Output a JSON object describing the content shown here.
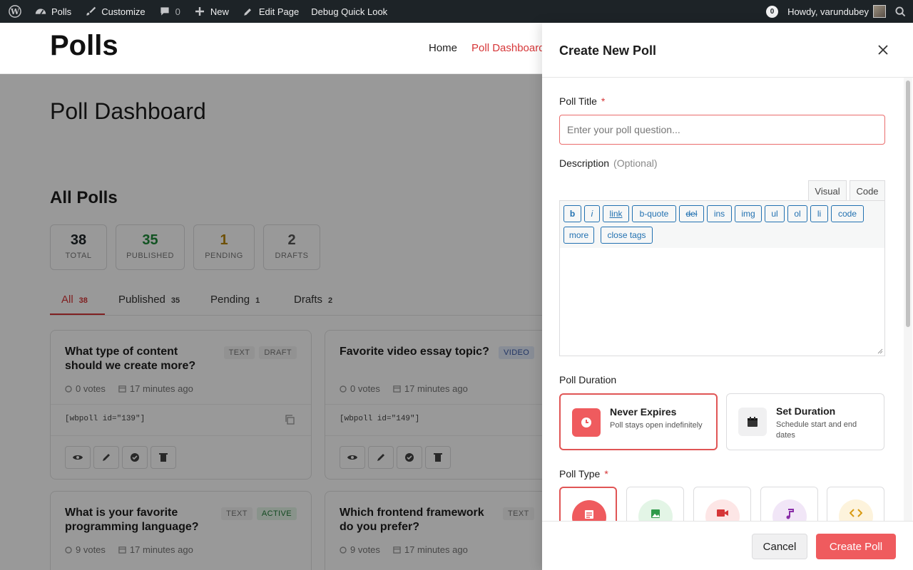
{
  "adminbar": {
    "site_name": "Polls",
    "customize": "Customize",
    "comments_count": "0",
    "new": "New",
    "edit_page": "Edit Page",
    "debug": "Debug Quick Look",
    "notifications_count": "0",
    "howdy": "Howdy, varundubey"
  },
  "site": {
    "title": "Polls",
    "nav": {
      "home": "Home",
      "dashboard": "Poll Dashboard"
    }
  },
  "page": {
    "title": "Poll Dashboard",
    "section_title": "All Polls",
    "stats": [
      {
        "value": "38",
        "label": "TOTAL",
        "color": "#1d1d1d"
      },
      {
        "value": "35",
        "label": "PUBLISHED",
        "color": "#1f8a3a"
      },
      {
        "value": "1",
        "label": "PENDING",
        "color": "#b8860b"
      },
      {
        "value": "2",
        "label": "DRAFTS",
        "color": "#555555"
      }
    ],
    "tabs": [
      {
        "label": "All",
        "count": "38"
      },
      {
        "label": "Published",
        "count": "35"
      },
      {
        "label": "Pending",
        "count": "1"
      },
      {
        "label": "Drafts",
        "count": "2"
      }
    ],
    "cards": [
      {
        "title": "What type of content should we create more?",
        "badges": [
          "TEXT",
          "DRAFT"
        ],
        "votes": "0 votes",
        "time": "17 minutes ago",
        "shortcode": "[wbpoll id=\"139\"]"
      },
      {
        "title": "Favorite video essay topic?",
        "badges": [
          "VIDEO"
        ],
        "votes": "0 votes",
        "time": "17 minutes ago",
        "shortcode": "[wbpoll id=\"149\"]"
      },
      {
        "title": "What is your favorite programming language?",
        "badges": [
          "TEXT",
          "ACTIVE"
        ],
        "votes": "9 votes",
        "time": "17 minutes ago"
      },
      {
        "title": "Which frontend framework do you prefer?",
        "badges": [
          "TEXT"
        ],
        "votes": "9 votes",
        "time": "17 minutes ago"
      }
    ]
  },
  "modal": {
    "title": "Create New Poll",
    "poll_title_label": "Poll Title",
    "required_mark": "*",
    "poll_title_placeholder": "Enter your poll question...",
    "description_label": "Description",
    "description_optional": "(Optional)",
    "editor_tabs": {
      "visual": "Visual",
      "code": "Code"
    },
    "quicktags": [
      "b",
      "i",
      "link",
      "b-quote",
      "del",
      "ins",
      "img",
      "ul",
      "ol",
      "li",
      "code",
      "more",
      "close tags"
    ],
    "duration_label": "Poll Duration",
    "duration_options": [
      {
        "title": "Never Expires",
        "desc": "Poll stays open indefinitely",
        "icon": "clock-icon"
      },
      {
        "title": "Set Duration",
        "desc": "Schedule start and end dates",
        "icon": "calendar-icon"
      }
    ],
    "type_label": "Poll Type",
    "type_icons": [
      "text-lines-icon",
      "image-icon",
      "video-camera-icon",
      "music-note-icon",
      "code-brackets-icon"
    ],
    "cancel": "Cancel",
    "create": "Create Poll"
  },
  "colors": {
    "accent": "#ef5b5e",
    "link": "#2271b1",
    "nav_active": "#d63638"
  }
}
